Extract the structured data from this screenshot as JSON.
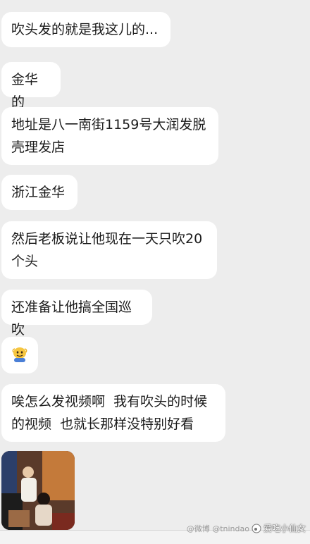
{
  "messages": [
    {
      "text": "吹头发的就是我这儿的..."
    },
    {
      "text": "金华的"
    },
    {
      "text": "地址是八一南街1159号大润发脱\n壳理发店"
    },
    {
      "text": "浙江金华"
    },
    {
      "text": "然后老板说让他现在一天只吹20\n个头"
    },
    {
      "text": "还准备让他搞全国巡吹"
    },
    {
      "emoji": "smiling-face-emoji"
    },
    {
      "text": "唉怎么发视频啊  我有吹头的时候\n的视频  也就长那样没特别好看"
    }
  ],
  "video": {
    "icon": "video-thumbnail"
  },
  "watermark": {
    "brand": "爱吃小仙女",
    "handle": "@微博  @tnindao"
  },
  "colors": {
    "background": "#ededed",
    "bubble": "#ffffff",
    "text": "#1b1b1b"
  }
}
